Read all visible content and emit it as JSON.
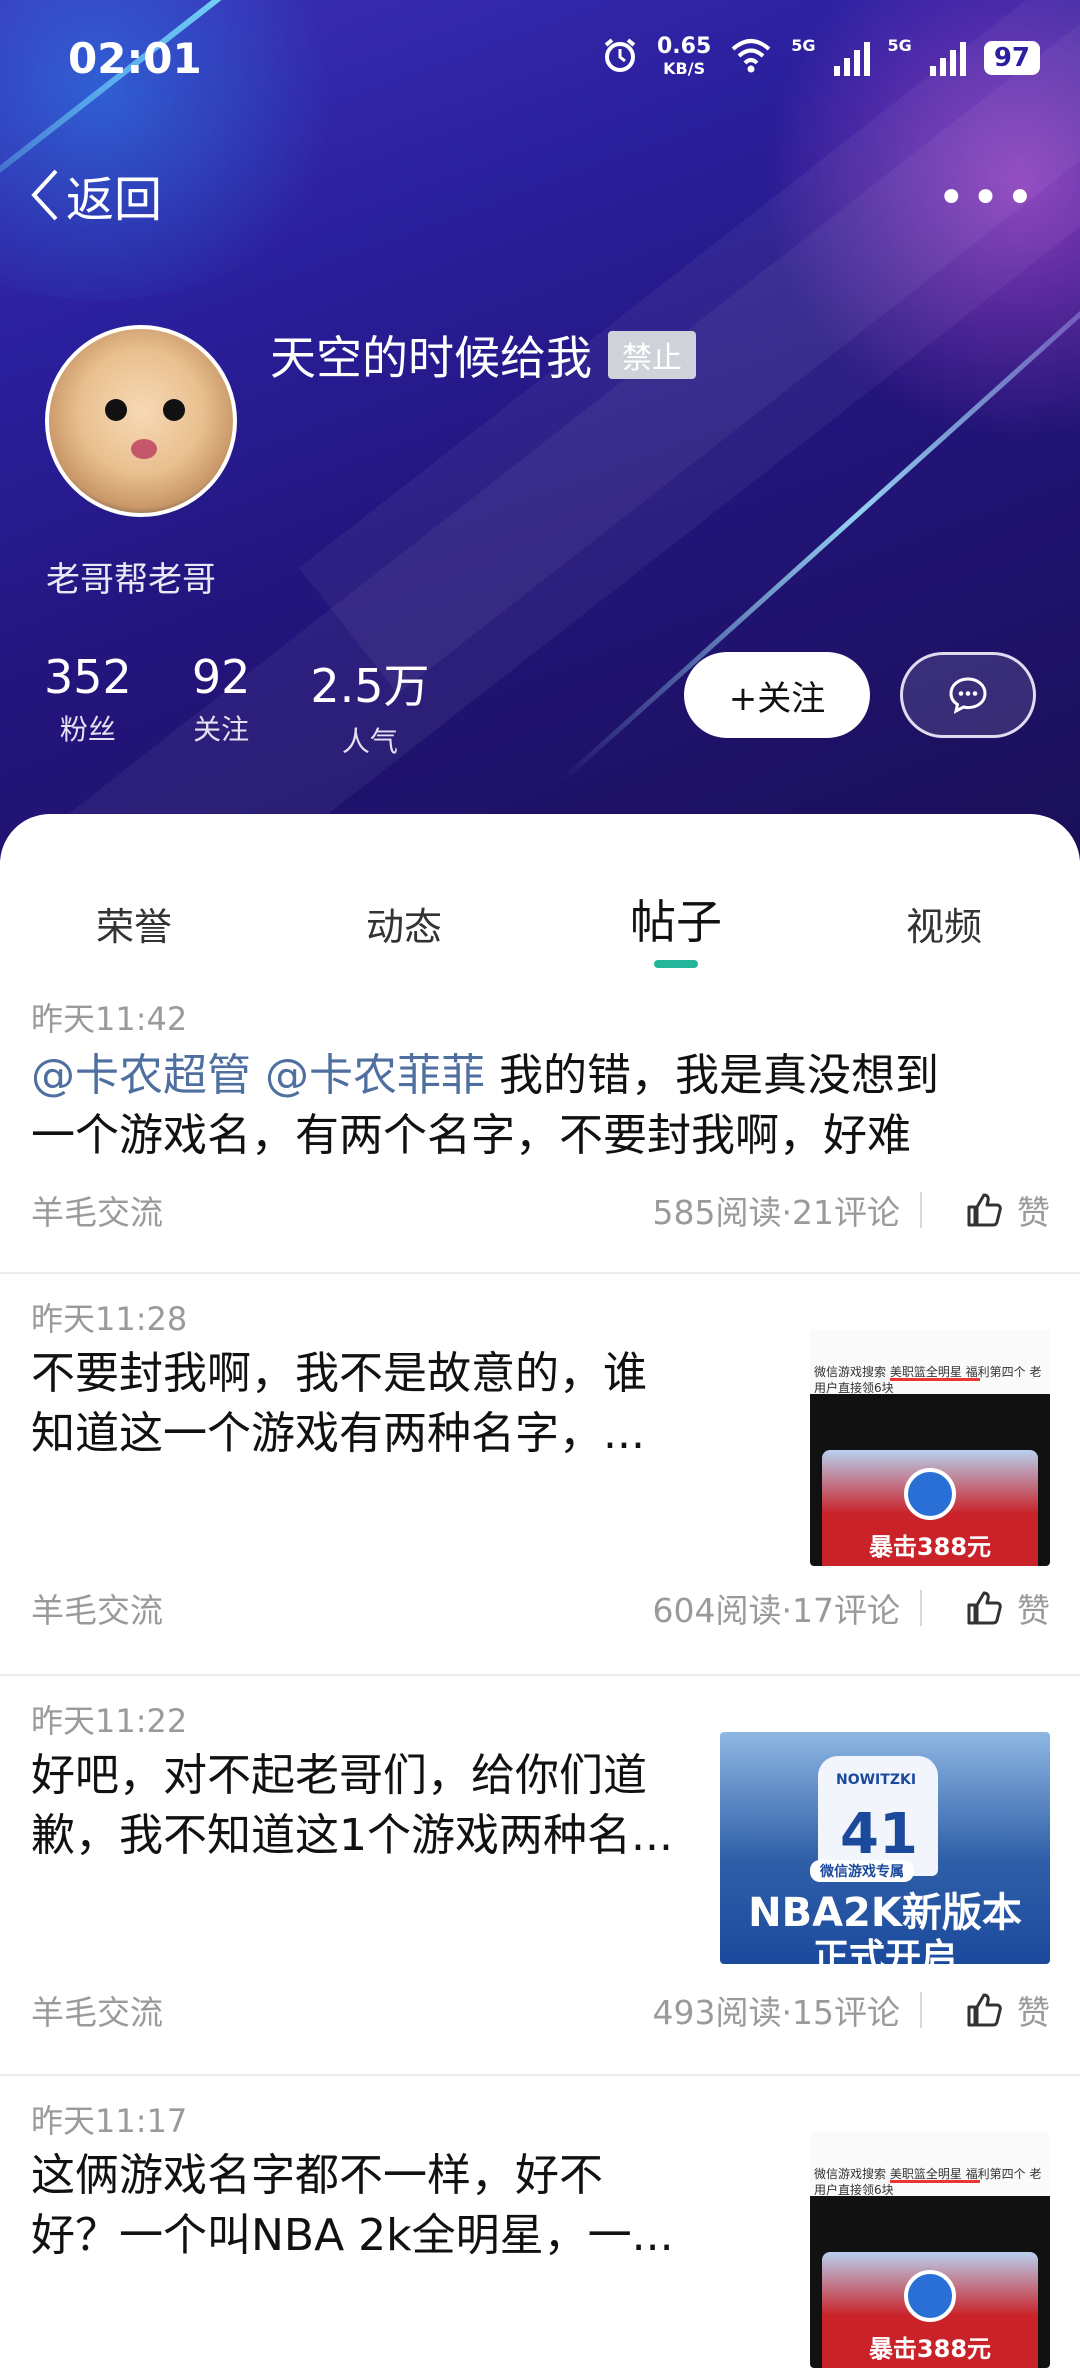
{
  "status_bar": {
    "time": "02:01",
    "speed_value": "0.65",
    "speed_unit": "KB/S",
    "net1": "5G",
    "net2": "5G",
    "battery": "97"
  },
  "nav": {
    "back_label": "返回",
    "more_label": "•••"
  },
  "profile": {
    "name": "天空的时候给我",
    "badge": "禁止",
    "tagline": "老哥帮老哥",
    "stats": [
      {
        "num": "352",
        "label": "粉丝"
      },
      {
        "num": "92",
        "label": "关注"
      },
      {
        "num": "2.5万",
        "label": "人气"
      }
    ],
    "follow_label": "+关注"
  },
  "tabs": [
    {
      "label": "荣誉",
      "active": false
    },
    {
      "label": "动态",
      "active": false
    },
    {
      "label": "帖子",
      "active": true
    },
    {
      "label": "视频",
      "active": false
    }
  ],
  "colors": {
    "accent": "#24b59b",
    "mention": "#4f6fa0"
  },
  "posts": [
    {
      "time": "昨天11:42",
      "mention1": "@卡农超管",
      "mention2": "@卡农菲菲",
      "line1_rest": " 我的错，我是真没想到",
      "line2": "一个游戏名，有两个名字，不要封我啊，好难",
      "channel": "羊毛交流",
      "metrics": "585阅读·21评论",
      "like": "赞"
    },
    {
      "time": "昨天11:28",
      "line1": "不要封我啊，我不是故意的，谁",
      "line2": "知道这一个游戏有两种名字，...",
      "channel": "羊毛交流",
      "metrics": "604阅读·17评论",
      "like": "赞",
      "thumb_caption": "微信游戏搜索 美职篮全明星 福利第四个 老用户直接领6块",
      "thumb_promo": "暴击388元"
    },
    {
      "time": "昨天11:22",
      "line1": "好吧，对不起老哥们，给你们道",
      "line2": "歉，我不知道这1个游戏两种名...",
      "channel": "羊毛交流",
      "metrics": "493阅读·15评论",
      "like": "赞",
      "thumb_jersey_name": "NOWITZKI",
      "thumb_jersey_num": "41",
      "thumb_tag": "微信游戏专属",
      "thumb_big": "NBA2K新版本",
      "thumb_big2": "正式开启"
    },
    {
      "time": "昨天11:17",
      "line1": "这俩游戏名字都不一样，好不",
      "line2": "好？一个叫NBA 2k全明星，一...",
      "thumb_caption": "微信游戏搜索 美职篮全明星 福利第四个 老用户直接领6块",
      "thumb_promo": "暴击388元"
    }
  ]
}
